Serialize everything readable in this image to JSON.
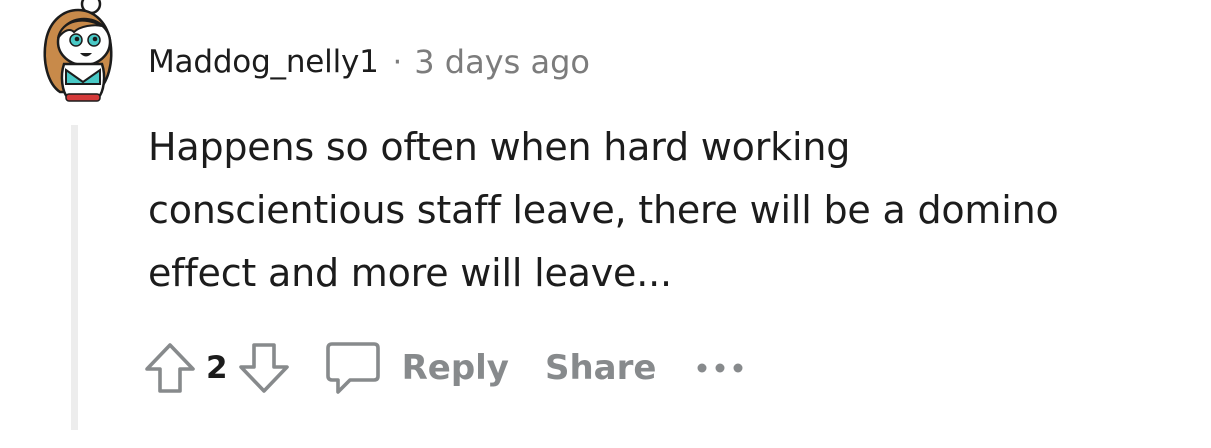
{
  "comment": {
    "author": "Maddog_nelly1",
    "separator": "·",
    "timestamp": "3 days ago",
    "body_lines": [
      "Happens so often when hard working",
      "conscientious staff leave, there will be a domino",
      "effect and more will leave..."
    ],
    "votes": "2"
  },
  "actions": {
    "reply_label": "Reply",
    "share_label": "Share"
  },
  "icons": {
    "avatar": "snoo-avatar-icon",
    "upvote": "upvote-arrow-icon",
    "downvote": "downvote-arrow-icon",
    "comment": "comment-bubble-icon",
    "more": "more-options-icon"
  },
  "colors": {
    "text_primary": "#1c1c1c",
    "text_muted": "#7c7c7c",
    "action_gray": "#878a8c",
    "thread_line": "#ededed",
    "avatar_hair": "#c88a4a",
    "avatar_accent": "#49c9c6"
  }
}
